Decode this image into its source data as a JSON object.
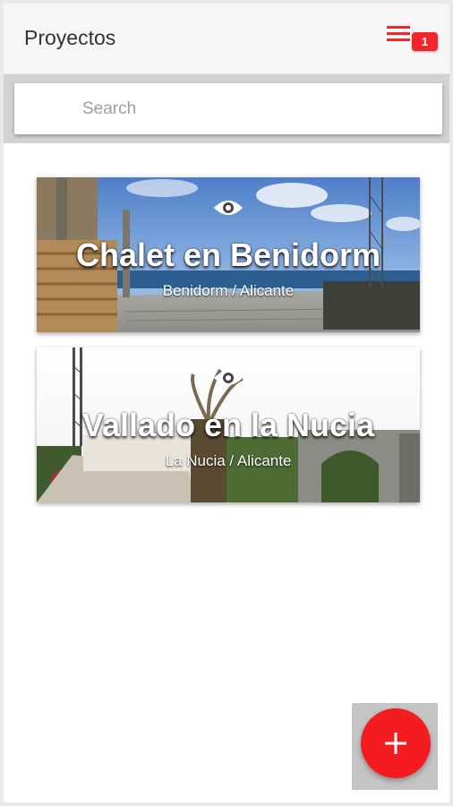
{
  "header": {
    "title": "Proyectos",
    "menu_icon": "list-menu-icon",
    "notification_count": "1",
    "badge_color": "#f1262a"
  },
  "search": {
    "placeholder": "Search",
    "value": ""
  },
  "projects": [
    {
      "name": "Chalet en Benidorm",
      "location": "Benidorm / Alicante",
      "icon": "eye-icon"
    },
    {
      "name": "Vallado en la Nucia",
      "location": "La Nucia / Alicante",
      "icon": "eye-icon"
    }
  ],
  "fab": {
    "icon": "plus-icon",
    "color": "#f41c20"
  }
}
